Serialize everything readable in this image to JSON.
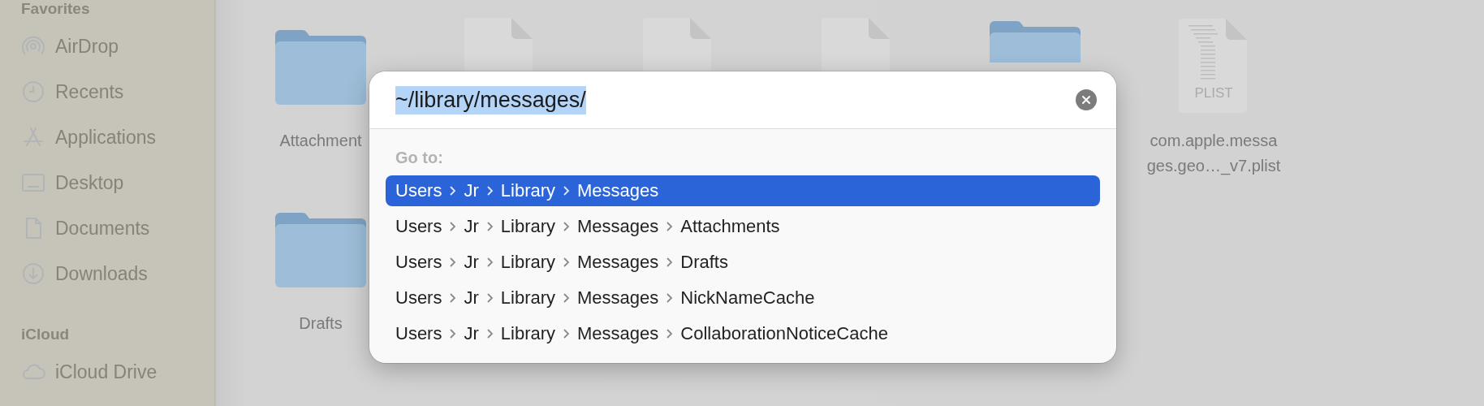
{
  "sidebar": {
    "sections": [
      {
        "title": "Favorites",
        "items": [
          {
            "label": "AirDrop"
          },
          {
            "label": "Recents"
          },
          {
            "label": "Applications"
          },
          {
            "label": "Desktop"
          },
          {
            "label": "Documents"
          },
          {
            "label": "Downloads"
          }
        ]
      },
      {
        "title": "iCloud",
        "items": [
          {
            "label": "iCloud Drive"
          }
        ]
      }
    ]
  },
  "files": [
    {
      "kind": "folder",
      "label_lines": [
        "Attachment"
      ]
    },
    {
      "kind": "document"
    },
    {
      "kind": "document"
    },
    {
      "kind": "document"
    },
    {
      "kind": "folder"
    },
    {
      "kind": "plist",
      "badge": "PLIST",
      "label_lines": [
        "com.apple.messa",
        "ges.geo…_v7.plist"
      ]
    },
    {
      "kind": "folder",
      "label_lines": [
        "Drafts"
      ]
    }
  ],
  "dialog": {
    "path_field": {
      "value": "~/library/messages/",
      "text_selected": true
    },
    "section_label": "Go to:",
    "suggestions": [
      {
        "segments": [
          "Users",
          "Jr",
          "Library",
          "Messages"
        ],
        "selected": true
      },
      {
        "segments": [
          "Users",
          "Jr",
          "Library",
          "Messages",
          "Attachments"
        ],
        "selected": false
      },
      {
        "segments": [
          "Users",
          "Jr",
          "Library",
          "Messages",
          "Drafts"
        ],
        "selected": false
      },
      {
        "segments": [
          "Users",
          "Jr",
          "Library",
          "Messages",
          "NickNameCache"
        ],
        "selected": false
      },
      {
        "segments": [
          "Users",
          "Jr",
          "Library",
          "Messages",
          "CollaborationNoticeCache"
        ],
        "selected": false
      }
    ]
  }
}
